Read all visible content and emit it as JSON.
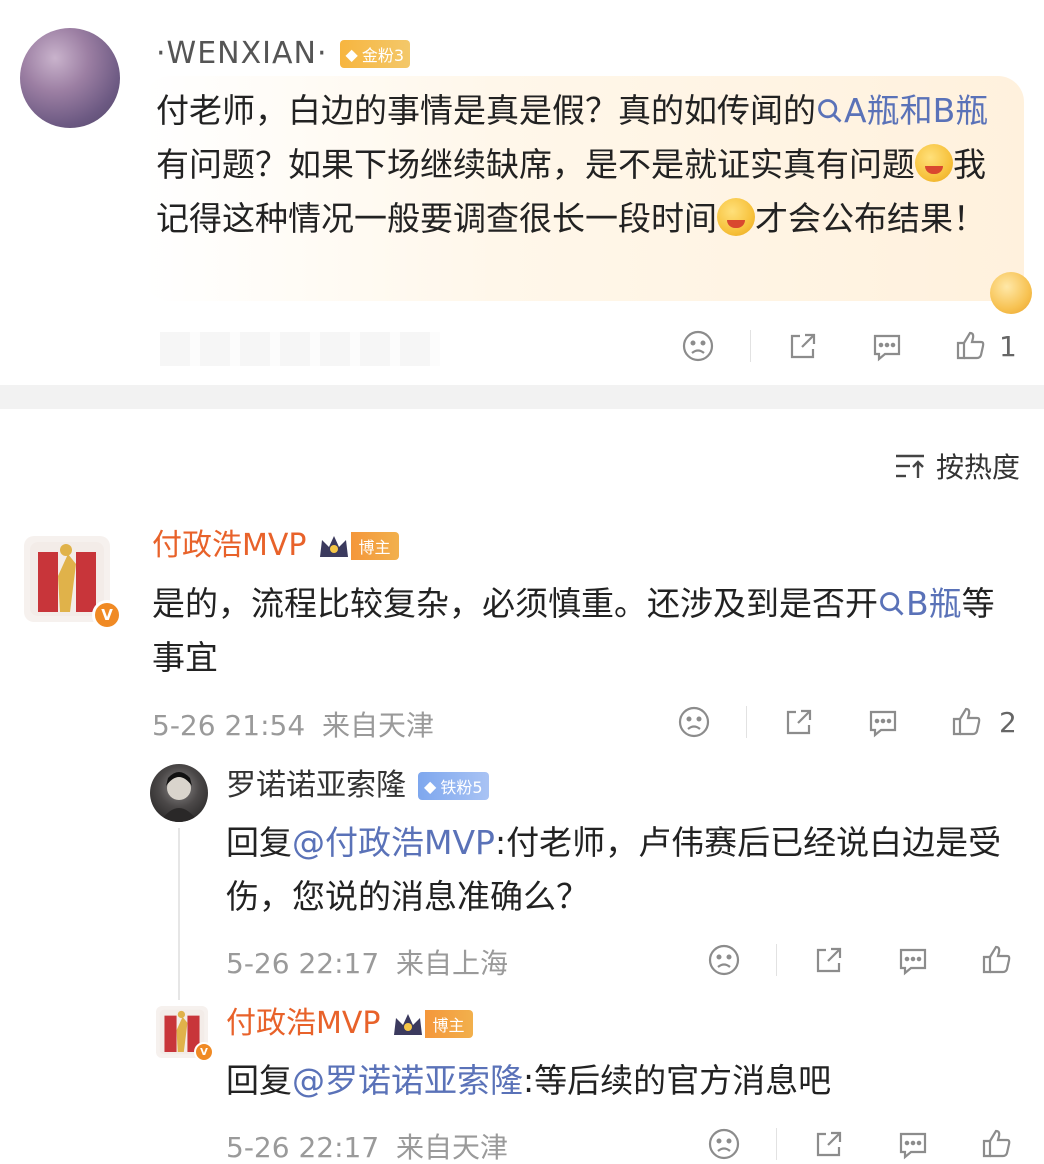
{
  "comment1": {
    "username": "·WENXIAN·",
    "fan_badge": "金粉3",
    "text_a": "付老师，白边的事情是真是假？真的如传闻的",
    "search_link_1": "A瓶和B瓶",
    "text_b": "有问题？如果下场继续缺席，是不是就证实真有问题",
    "text_c": "我记得这种情况一般要调查很长一段时间",
    "text_d": "才会公布结果！",
    "like_count": "1"
  },
  "sort": {
    "label": "按热度"
  },
  "comment2": {
    "username": "付政浩MVP",
    "role_badge": "博主",
    "text_a": "是的，流程比较复杂，必须慎重。还涉及到是否开",
    "search_link": "B瓶",
    "text_b": "等事宜",
    "time": "5-26 21:54",
    "location": "来自天津",
    "like_count": "2"
  },
  "reply1": {
    "username": "罗诺诺亚索隆",
    "fan_badge": "铁粉5",
    "reply_prefix": "回复",
    "mention": "@付政浩MVP",
    "text": ":付老师，卢伟赛后已经说白边是受伤，您说的消息准确么？",
    "time": "5-26 22:17",
    "location": "来自上海"
  },
  "reply2": {
    "username": "付政浩MVP",
    "role_badge": "博主",
    "reply_prefix": "回复",
    "mention": "@罗诺诺亚索隆",
    "text": ":等后续的官方消息吧",
    "time": "5-26 22:17",
    "location": "来自天津"
  },
  "icons": {
    "dislike": "sad-face-icon",
    "share": "share-icon",
    "comment": "comment-icon",
    "like": "thumbs-up-icon",
    "search": "search-icon",
    "sort": "sort-icon"
  },
  "colors": {
    "username_orange": "#e8622a",
    "link_blue": "#5a72b8",
    "gold_badge": "#f7b53f",
    "iron_badge": "#7ea7ee"
  }
}
